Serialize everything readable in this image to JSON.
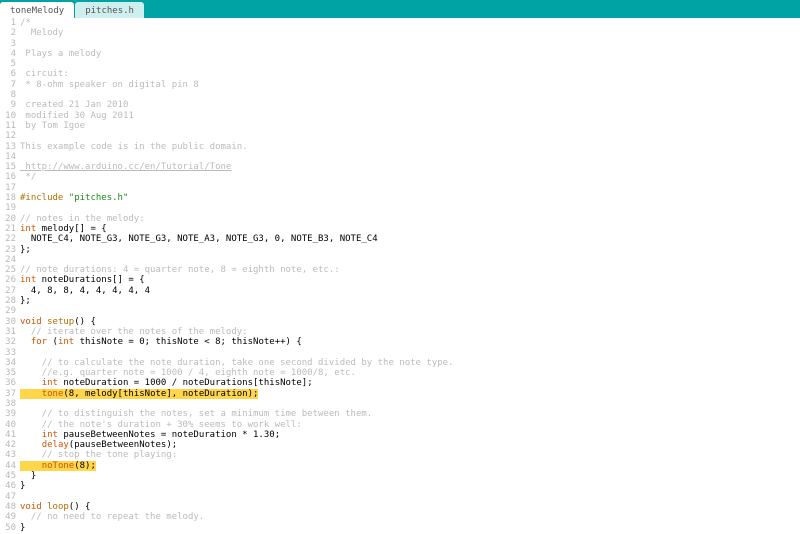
{
  "tabs": {
    "active": "toneMelody",
    "inactive": "pitches.h"
  },
  "code": [
    {
      "n": 1,
      "segs": [
        {
          "c": "cmt",
          "t": "/*"
        }
      ]
    },
    {
      "n": 2,
      "segs": [
        {
          "c": "cmt",
          "t": "  Melody"
        }
      ]
    },
    {
      "n": 3,
      "segs": [
        {
          "c": "cmt",
          "t": ""
        }
      ]
    },
    {
      "n": 4,
      "segs": [
        {
          "c": "cmt",
          "t": " Plays a melody"
        }
      ]
    },
    {
      "n": 5,
      "segs": [
        {
          "c": "cmt",
          "t": ""
        }
      ]
    },
    {
      "n": 6,
      "segs": [
        {
          "c": "cmt",
          "t": " circuit:"
        }
      ]
    },
    {
      "n": 7,
      "segs": [
        {
          "c": "cmt",
          "t": " * 8-ohm speaker on digital pin 8"
        }
      ]
    },
    {
      "n": 8,
      "segs": [
        {
          "c": "cmt",
          "t": ""
        }
      ]
    },
    {
      "n": 9,
      "segs": [
        {
          "c": "cmt",
          "t": " created 21 Jan 2010"
        }
      ]
    },
    {
      "n": 10,
      "segs": [
        {
          "c": "cmt",
          "t": " modified 30 Aug 2011"
        }
      ]
    },
    {
      "n": 11,
      "segs": [
        {
          "c": "cmt",
          "t": " by Tom Igoe"
        }
      ]
    },
    {
      "n": 12,
      "segs": [
        {
          "c": "cmt",
          "t": ""
        }
      ]
    },
    {
      "n": 13,
      "segs": [
        {
          "c": "cmt",
          "t": "This example code is in the public domain."
        }
      ]
    },
    {
      "n": 14,
      "segs": [
        {
          "c": "cmt",
          "t": ""
        }
      ]
    },
    {
      "n": 15,
      "segs": [
        {
          "c": "cmt link",
          "t": " http://www.arduino.cc/en/Tutorial/Tone"
        }
      ]
    },
    {
      "n": 16,
      "segs": [
        {
          "c": "cmt",
          "t": " */"
        }
      ]
    },
    {
      "n": 17,
      "segs": [
        {
          "c": "",
          "t": ""
        }
      ]
    },
    {
      "n": 18,
      "segs": [
        {
          "c": "pre",
          "t": "#include "
        },
        {
          "c": "str",
          "t": "\"pitches.h\""
        }
      ]
    },
    {
      "n": 19,
      "segs": [
        {
          "c": "",
          "t": ""
        }
      ]
    },
    {
      "n": 20,
      "segs": [
        {
          "c": "cmt",
          "t": "// notes in the melody:"
        }
      ]
    },
    {
      "n": 21,
      "segs": [
        {
          "c": "kw",
          "t": "int"
        },
        {
          "c": "",
          "t": " melody[] = {"
        }
      ]
    },
    {
      "n": 22,
      "segs": [
        {
          "c": "",
          "t": "  NOTE_C4, NOTE_G3, NOTE_G3, NOTE_A3, NOTE_G3, 0, NOTE_B3, NOTE_C4"
        }
      ]
    },
    {
      "n": 23,
      "segs": [
        {
          "c": "",
          "t": "};"
        }
      ]
    },
    {
      "n": 24,
      "segs": [
        {
          "c": "",
          "t": ""
        }
      ]
    },
    {
      "n": 25,
      "segs": [
        {
          "c": "cmt",
          "t": "// note durations: 4 = quarter note, 8 = eighth note, etc.:"
        }
      ]
    },
    {
      "n": 26,
      "segs": [
        {
          "c": "kw",
          "t": "int"
        },
        {
          "c": "",
          "t": " noteDurations[] = {"
        }
      ]
    },
    {
      "n": 27,
      "segs": [
        {
          "c": "",
          "t": "  4, 8, 8, 4, 4, 4, 4, 4"
        }
      ]
    },
    {
      "n": 28,
      "segs": [
        {
          "c": "",
          "t": "};"
        }
      ]
    },
    {
      "n": 29,
      "segs": [
        {
          "c": "",
          "t": ""
        }
      ]
    },
    {
      "n": 30,
      "segs": [
        {
          "c": "kw",
          "t": "void"
        },
        {
          "c": "",
          "t": " "
        },
        {
          "c": "fn",
          "t": "setup"
        },
        {
          "c": "",
          "t": "() {"
        }
      ]
    },
    {
      "n": 31,
      "segs": [
        {
          "c": "cmt",
          "t": "  // iterate over the notes of the melody:"
        }
      ]
    },
    {
      "n": 32,
      "segs": [
        {
          "c": "",
          "t": "  "
        },
        {
          "c": "kw",
          "t": "for"
        },
        {
          "c": "",
          "t": " ("
        },
        {
          "c": "kw",
          "t": "int"
        },
        {
          "c": "",
          "t": " thisNote = 0; thisNote < 8; thisNote++) {"
        }
      ]
    },
    {
      "n": 33,
      "segs": [
        {
          "c": "",
          "t": ""
        }
      ]
    },
    {
      "n": 34,
      "segs": [
        {
          "c": "cmt",
          "t": "    // to calculate the note duration, take one second divided by the note type."
        }
      ]
    },
    {
      "n": 35,
      "segs": [
        {
          "c": "cmt",
          "t": "    //e.g. quarter note = 1000 / 4, eighth note = 1000/8, etc."
        }
      ]
    },
    {
      "n": 36,
      "segs": [
        {
          "c": "",
          "t": "    "
        },
        {
          "c": "kw",
          "t": "int"
        },
        {
          "c": "",
          "t": " noteDuration = 1000 / noteDurations[thisNote];"
        }
      ]
    },
    {
      "n": 37,
      "hl": true,
      "segs": [
        {
          "c": "",
          "t": "    "
        },
        {
          "c": "fn2",
          "t": "tone"
        },
        {
          "c": "",
          "t": "(8, melody[thisNote], noteDuration);"
        }
      ]
    },
    {
      "n": 38,
      "segs": [
        {
          "c": "",
          "t": ""
        }
      ]
    },
    {
      "n": 39,
      "segs": [
        {
          "c": "cmt",
          "t": "    // to distinguish the notes, set a minimum time between them."
        }
      ]
    },
    {
      "n": 40,
      "segs": [
        {
          "c": "cmt",
          "t": "    // the note's duration + 30% seems to work well:"
        }
      ]
    },
    {
      "n": 41,
      "segs": [
        {
          "c": "",
          "t": "    "
        },
        {
          "c": "kw",
          "t": "int"
        },
        {
          "c": "",
          "t": " pauseBetweenNotes = noteDuration * 1.30;"
        }
      ]
    },
    {
      "n": 42,
      "segs": [
        {
          "c": "",
          "t": "    "
        },
        {
          "c": "fn2",
          "t": "delay"
        },
        {
          "c": "",
          "t": "(pauseBetweenNotes);"
        }
      ]
    },
    {
      "n": 43,
      "segs": [
        {
          "c": "cmt",
          "t": "    // stop the tone playing:"
        }
      ]
    },
    {
      "n": 44,
      "hl": true,
      "segs": [
        {
          "c": "",
          "t": "    "
        },
        {
          "c": "fn2",
          "t": "noTone"
        },
        {
          "c": "",
          "t": "(8);"
        }
      ]
    },
    {
      "n": 45,
      "segs": [
        {
          "c": "",
          "t": "  }"
        }
      ]
    },
    {
      "n": 46,
      "segs": [
        {
          "c": "",
          "t": "}"
        }
      ]
    },
    {
      "n": 47,
      "segs": [
        {
          "c": "",
          "t": ""
        }
      ]
    },
    {
      "n": 48,
      "segs": [
        {
          "c": "kw",
          "t": "void"
        },
        {
          "c": "",
          "t": " "
        },
        {
          "c": "fn",
          "t": "loop"
        },
        {
          "c": "",
          "t": "() {"
        }
      ]
    },
    {
      "n": 49,
      "segs": [
        {
          "c": "cmt",
          "t": "  // no need to repeat the melody."
        }
      ]
    },
    {
      "n": 50,
      "segs": [
        {
          "c": "",
          "t": "}"
        }
      ]
    }
  ]
}
